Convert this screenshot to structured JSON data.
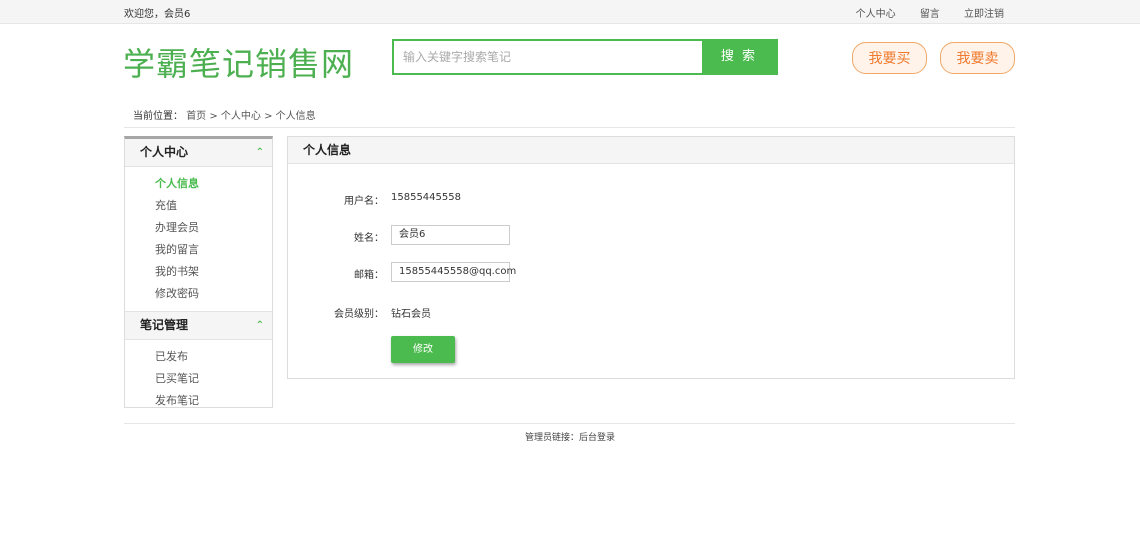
{
  "topbar": {
    "welcome": "欢迎您，会员6",
    "links": [
      "个人中心",
      "留言",
      "立即注销"
    ]
  },
  "header": {
    "logo": "学霸笔记销售网",
    "search_placeholder": "输入关键字搜索笔记",
    "search_button": "搜 索",
    "buy_button": "我要买",
    "sell_button": "我要卖"
  },
  "breadcrumb": {
    "label": "当前位置：",
    "trail": "首页 > 个人中心 > 个人信息"
  },
  "sidebar": {
    "sections": [
      {
        "title": "个人中心",
        "items": [
          "个人信息",
          "充值",
          "办理会员",
          "我的留言",
          "我的书架",
          "修改密码"
        ]
      },
      {
        "title": "笔记管理",
        "items": [
          "已发布",
          "已买笔记",
          "发布笔记"
        ]
      }
    ],
    "active_item": "个人信息"
  },
  "panel": {
    "title": "个人信息",
    "username_label": "用户名：",
    "username_value": "15855445558",
    "name_label": "姓名：",
    "name_value": "会员6",
    "email_label": "邮箱：",
    "email_value": "15855445558@qq.com",
    "level_label": "会员级别：",
    "level_value": "钻石会员",
    "submit_label": "修改"
  },
  "footer": {
    "text": "管理员链接：后台登录"
  },
  "colors": {
    "accent": "#4cbb4f",
    "orange": "#ef7a2e"
  }
}
